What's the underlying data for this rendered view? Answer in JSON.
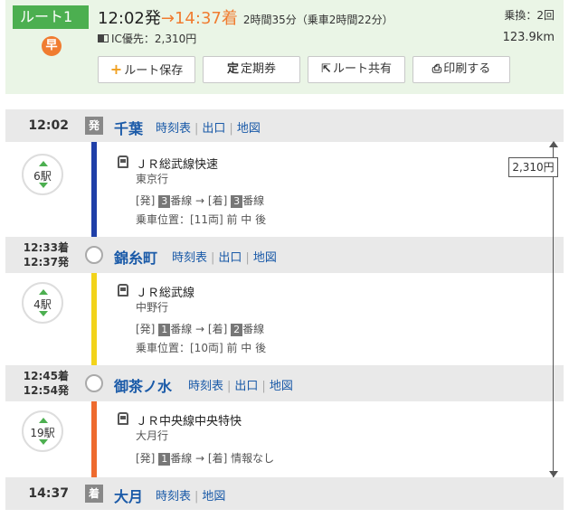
{
  "header": {
    "route_label": "ルート1",
    "fast_icon": "早",
    "depart": "12:02発",
    "arrow": "→",
    "arrive": "14:37着",
    "duration": "2時間35分（乗車2時間22分）",
    "transfers": "乗換：2回",
    "ic_fare": "IC優先：2,310円",
    "distance": "123.9km",
    "buttons": [
      {
        "icon": "+",
        "label": "ルート保存"
      },
      {
        "icon": "定",
        "label": "定期券"
      },
      {
        "icon": "⇱",
        "label": "ルート共有"
      },
      {
        "icon": "⎙",
        "label": "印刷する"
      }
    ]
  },
  "fare_total": "2,310円",
  "stops": [
    {
      "time": "12:02",
      "badge": "発",
      "name": "千葉",
      "links": [
        "時刻表",
        "出口",
        "地図"
      ]
    },
    {
      "time_arr": "12:33着",
      "time_dep": "12:37発",
      "name": "錦糸町",
      "links": [
        "時刻表",
        "出口",
        "地図"
      ]
    },
    {
      "time_arr": "12:45着",
      "time_dep": "12:54発",
      "name": "御茶ノ水",
      "links": [
        "時刻表",
        "出口",
        "地図"
      ]
    },
    {
      "time": "14:37",
      "badge": "着",
      "name": "大月",
      "links": [
        "時刻表",
        "地図"
      ]
    }
  ],
  "segments": [
    {
      "count": "6駅",
      "train": "ＪＲ総武線快速",
      "dest": "東京行",
      "plat_dep_pre": "[発]",
      "plat_dep": "3",
      "plat_mid": "番線 → [着]",
      "plat_arr": "3",
      "plat_post": "番線",
      "pos": "乗車位置：[11両] 前 中 後",
      "color": "#1f3fa8"
    },
    {
      "count": "4駅",
      "train": "ＪＲ総武線",
      "dest": "中野行",
      "plat_dep_pre": "[発]",
      "plat_dep": "1",
      "plat_mid": "番線 → [着]",
      "plat_arr": "2",
      "plat_post": "番線",
      "pos": "乗車位置：[10両] 前 中 後",
      "color": "#f2d31a"
    },
    {
      "count": "19駅",
      "train": "ＪＲ中央線中央特快",
      "dest": "大月行",
      "plat_dep_pre": "[発]",
      "plat_dep": "1",
      "plat_mid": "番線 → [着] 情報なし",
      "pos": "",
      "color": "#ee6a2e"
    }
  ]
}
